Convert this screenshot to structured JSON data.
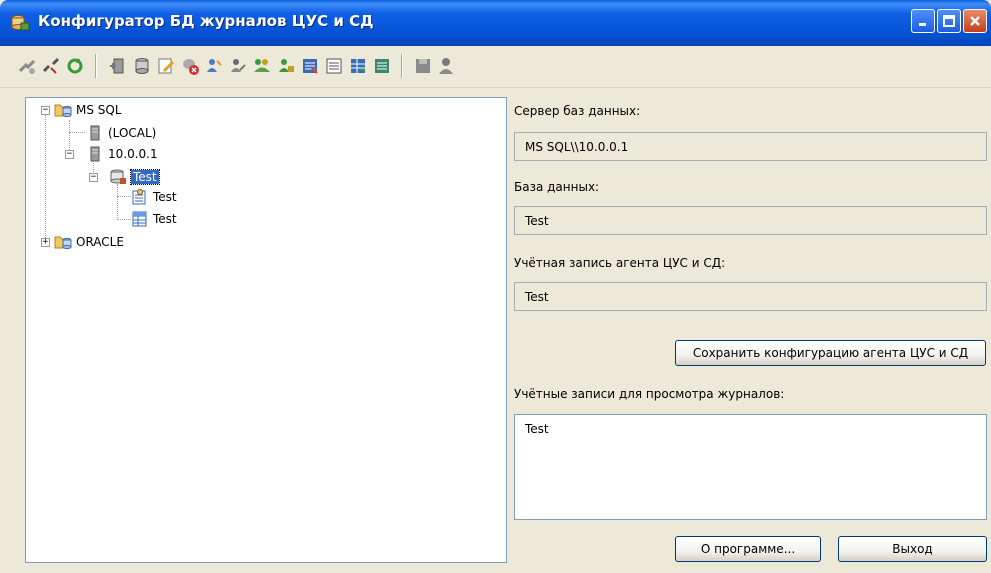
{
  "window": {
    "title": "Конфигуратор БД журналов ЦУС и СД"
  },
  "toolbar": {
    "icons": [
      "connect-icon",
      "disconnect-icon",
      "refresh-icon",
      "add-server-icon",
      "add-database-icon",
      "edit-icon",
      "delete-icon",
      "user-add-icon",
      "user-edit-icon",
      "user-group-icon",
      "user-remove-icon",
      "journal-add-icon",
      "journal-list-icon",
      "journal-grid-icon",
      "journal-remove-icon",
      "save-icon",
      "agent-icon"
    ]
  },
  "tree": {
    "mssql": "MS SQL",
    "local": "(LOCAL)",
    "server": "10.0.0.1",
    "database": "Test",
    "child1": "Test",
    "child2": "Test",
    "oracle": "ORACLE"
  },
  "form": {
    "server_label": "Сервер баз данных:",
    "server_value": "MS SQL\\\\10.0.0.1",
    "database_label": "База данных:",
    "database_value": "Test",
    "agent_label": "Учётная запись агента ЦУС и СД:",
    "agent_value": "Test",
    "save_button": "Сохранить конфигурацию агента ЦУС и СД",
    "viewers_label": "Учётные записи для просмотра журналов:",
    "viewers_value": "Test"
  },
  "footer": {
    "about_button": "О программе...",
    "exit_button": "Выход"
  }
}
